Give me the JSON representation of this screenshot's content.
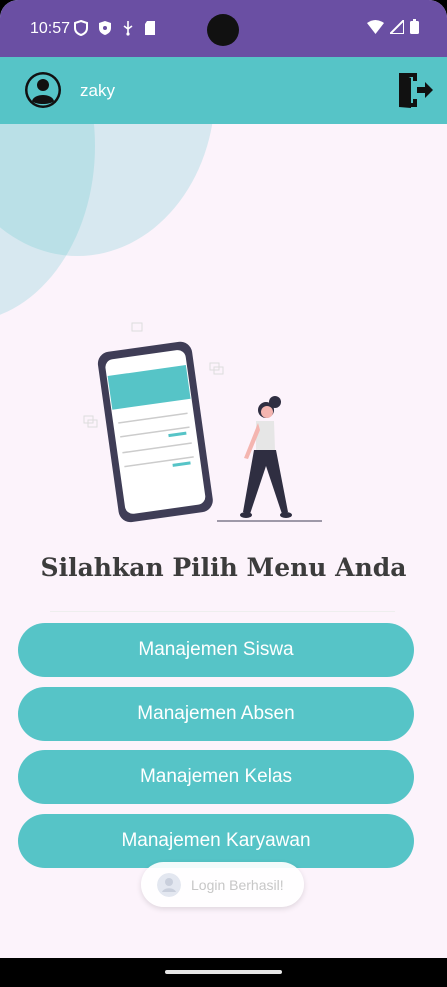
{
  "status": {
    "time": "10:57"
  },
  "appbar": {
    "username": "zaky"
  },
  "main": {
    "title": "Silahkan Pilih Menu Anda",
    "menu": [
      {
        "label": "Manajemen Siswa"
      },
      {
        "label": "Manajemen Absen"
      },
      {
        "label": "Manajemen Kelas"
      },
      {
        "label": "Manajemen Karyawan"
      }
    ]
  },
  "toast": {
    "message": "Login Berhasil!"
  },
  "colors": {
    "statusbar": "#6a4fa3",
    "accent": "#56c4c7",
    "background": "#fcf3fb",
    "title": "#3c3c3c"
  },
  "icons": {
    "status_left": [
      "shield-icon",
      "vpn-icon",
      "usb-icon",
      "sd-card-icon"
    ],
    "status_right": [
      "wifi-icon",
      "signal-icon",
      "battery-icon"
    ],
    "appbar_left": "account-circle-icon",
    "appbar_right": "logout-icon"
  }
}
